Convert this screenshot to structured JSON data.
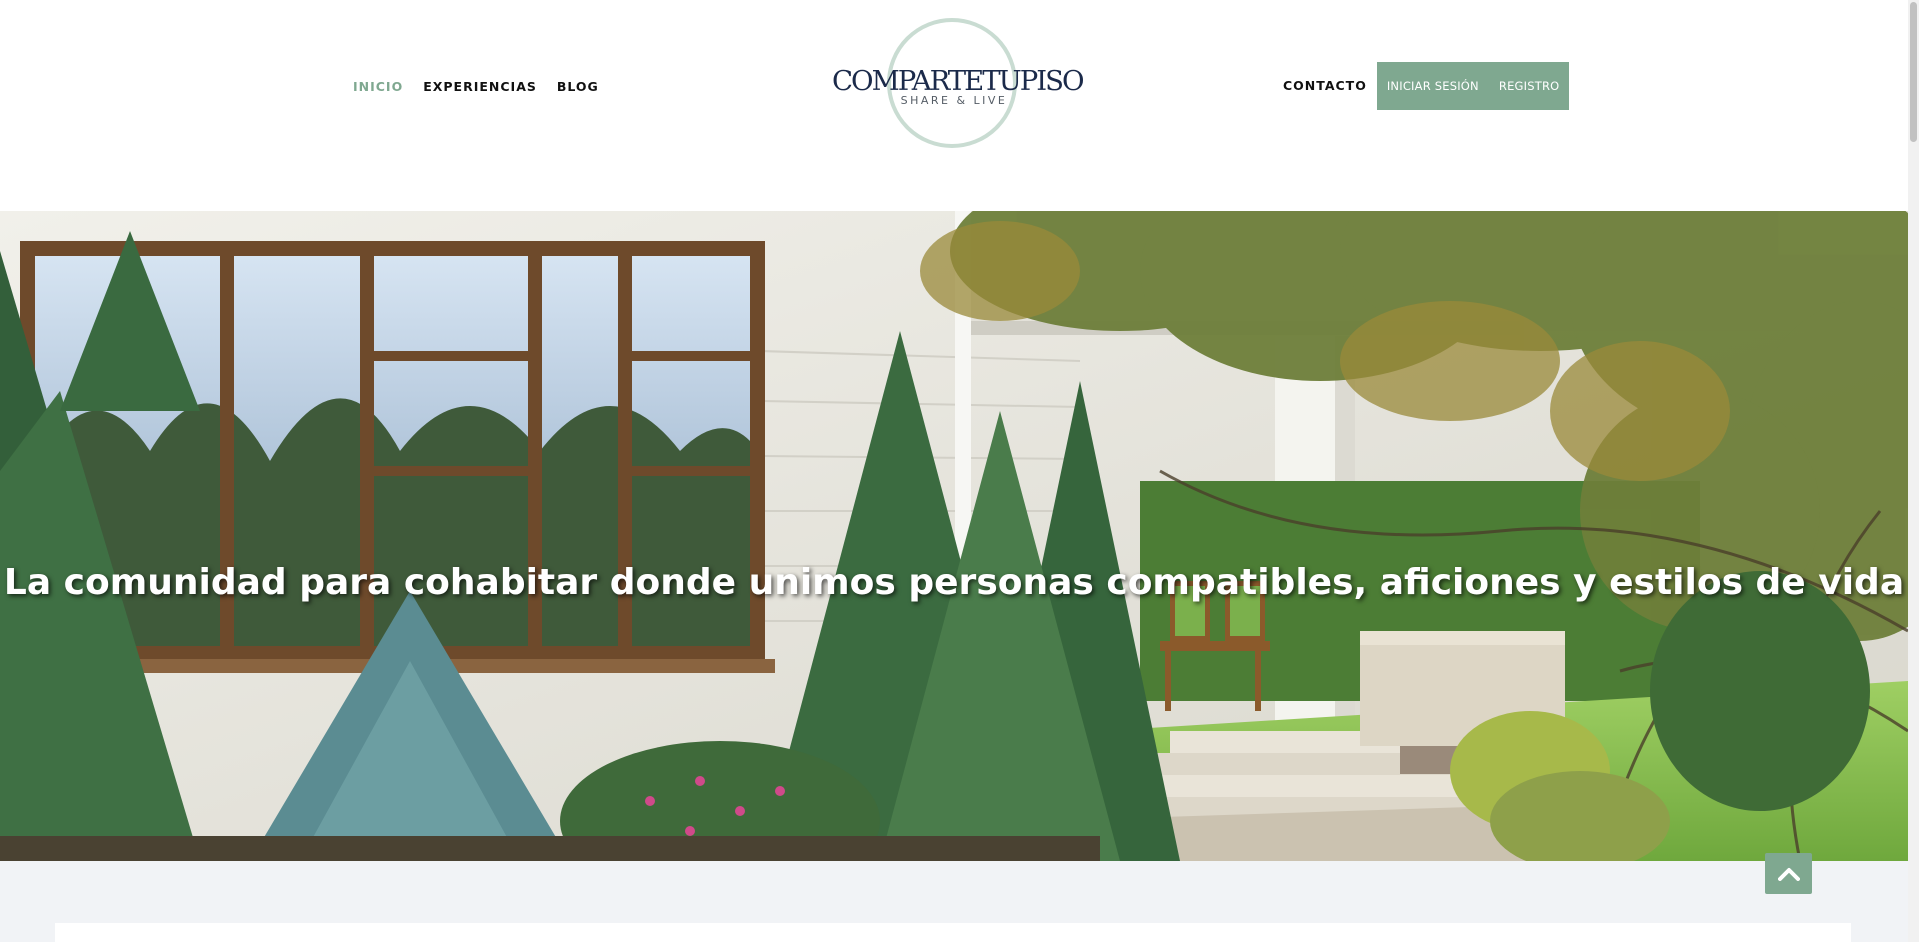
{
  "header": {
    "nav_left": [
      {
        "label": "INICIO",
        "active": true
      },
      {
        "label": "EXPERIENCIAS",
        "active": false
      },
      {
        "label": "BLOG",
        "active": false
      }
    ],
    "logo": {
      "name": "COMPARTETUPISO",
      "tagline": "SHARE & LIVE"
    },
    "nav_right": {
      "contact_label": "CONTACTO",
      "login_label": "INICIAR SESIÓN",
      "register_label": "REGISTRO"
    }
  },
  "hero": {
    "title": "La comunidad para cohabitar donde unimos personas compatibles, aficiones y estilos de vida",
    "image_icon": "house-garden-photo"
  },
  "scroll_top": {
    "icon": "chevron-up-icon"
  },
  "colors": {
    "accent": "#7fa890",
    "logo_ring": "#c9dcd2",
    "logo_text": "#1b2a4a",
    "page_background": "#f1f3f6"
  }
}
